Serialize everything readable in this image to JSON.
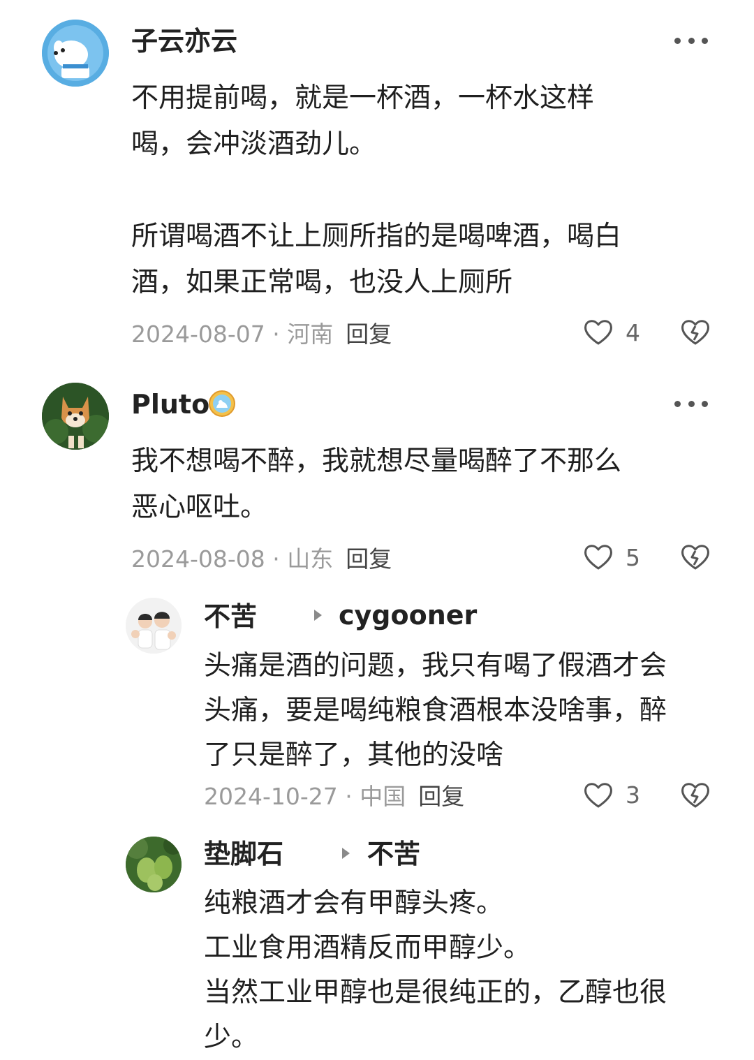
{
  "comments": [
    {
      "user": "子云亦云",
      "body": "不用提前喝，就是一杯酒，一杯水这样\n喝，会冲淡酒劲儿。\n\n所谓喝酒不让上厕所指的是喝啤酒，喝白\n酒，如果正常喝，也没人上厕所",
      "date": "2024-08-07",
      "location": "河南",
      "reply_label": "回复",
      "likes": "4"
    },
    {
      "user": "Pluto",
      "body": "我不想喝不醉，我就想尽量喝醉了不那么\n恶心呕吐。",
      "date": "2024-08-08",
      "location": "山东",
      "reply_label": "回复",
      "likes": "5"
    },
    {
      "user": "不苦",
      "reply_to": "cygooner",
      "body": "头痛是酒的问题，我只有喝了假酒才会\n头痛，要是喝纯粮食酒根本没啥事，醉\n了只是醉了，其他的没啥",
      "date": "2024-10-27",
      "location": "中国",
      "reply_label": "回复",
      "likes": "3"
    },
    {
      "user": "垫脚石",
      "reply_to": "不苦",
      "body": "纯粮酒才会有甲醇头疼。\n工业食用酒精反而甲醇少。\n当然工业甲醇也是很纯正的，乙醇也很\n少。"
    }
  ],
  "meta_separator": " · "
}
